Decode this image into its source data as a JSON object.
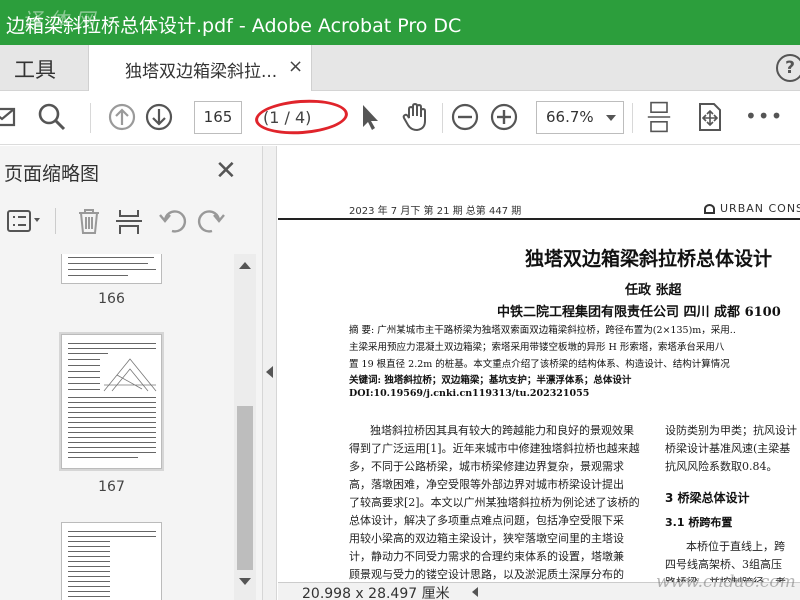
{
  "window": {
    "title": "边箱梁斜拉桥总体设计.pdf - Adobe Acrobat Pro DC",
    "watermark": "译 体 网"
  },
  "tabs": {
    "tools": "工具",
    "document": "独塔双边箱梁斜拉...",
    "close": "×"
  },
  "help": "?",
  "toolbar": {
    "page_number": "165",
    "page_count": "(1 / 4)",
    "zoom": "66.7%",
    "more": "•••"
  },
  "left_panel": {
    "title": "页面缩略图",
    "close": "✕",
    "thumbnails": [
      {
        "label": "166"
      },
      {
        "label": "167"
      },
      {
        "label": ""
      }
    ]
  },
  "document": {
    "header": "2023 年 7 月下    第 21 期    总第 447 期",
    "journal": "URBAN   CONS",
    "title": "独塔双边箱梁斜拉桥总体设计",
    "authors": "任政   张超",
    "affiliation": "中铁二院工程集团有限责任公司   四川   成都   6100",
    "abstract_lines": [
      "摘  要: 广州某城市主干路桥梁为独塔双索面双边箱梁斜拉桥，跨径布置为(2×135)m，采用..",
      "主梁采用预应力混凝土双边箱梁；索塔采用带镂空板墩的异形 H 形索塔，索塔承台采用八",
      "置 19 根直径 2.2m 的桩基。本文重点介绍了该桥梁的结构体系、构造设计、结构计算情况",
      "关键词: 独塔斜拉桥；双边箱梁；基坑支护；半漂浮体系；总体设计",
      "DOI:10.19569/j.cnki.cn119313/tu.202321055"
    ],
    "col1_lines": [
      "独塔斜拉桥因其具有较大的跨越能力和良好的景观效果",
      "得到了广泛运用[1]。近年来城市中修建独塔斜拉桥也越来越",
      "多，不同于公路桥梁，城市桥梁修建边界复杂，景观需求",
      "高，落墩困难，净空受限等外部边界对城市桥梁设计提出",
      "了较高要求[2]。本文以广州某独塔斜拉桥为例论述了该桥的",
      "总体设计，解决了多项重点难点问题，包括净空受限下采",
      "用较小梁高的双边箱主梁设计，狭窄落墩空间里的主塔设",
      "计，静动力不同受力需求的合理约束体系的设置，塔墩兼",
      "顾景观与受力的镂空设计思路，以及淤泥质土深厚分布的"
    ],
    "col2_lines_top": [
      "设防类别为甲类；抗风设计",
      "桥梁设计基准风速(主梁基",
      "抗风风险系数取0.84。"
    ],
    "section_3": "3 桥梁总体设计",
    "section_3_1": "3.1  桥跨布置",
    "col2_lines_bottom": [
      "本桥位于直线上，跨",
      "四号线高架桥、3组高压",
      "路桥梁，并控制跨径，考"
    ]
  },
  "status": {
    "dimensions": "20.998 x 28.497 厘米"
  },
  "watermark_br": "www.cndao.com",
  "colors": {
    "title_bar": "#2c9e3c",
    "annotation_oval": "#e0242b"
  }
}
